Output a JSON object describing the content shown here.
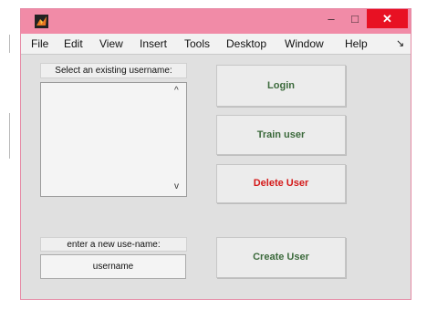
{
  "window": {
    "title_controls": {
      "minimize": "–",
      "maximize": "□",
      "close": "✕"
    }
  },
  "menu": {
    "items": [
      "File",
      "Edit",
      "View",
      "Insert",
      "Tools",
      "Desktop",
      "Window",
      "Help"
    ],
    "overflow_glyph": "↘"
  },
  "panel": {
    "select_label": "Select an existing username:",
    "new_label": "enter a new use-name:",
    "username_value": "username",
    "list_scroll_up": "^",
    "list_scroll_down": "v"
  },
  "buttons": {
    "login": "Login",
    "train": "Train user",
    "delete": "Delete User",
    "create": "Create User"
  },
  "colors": {
    "title_bar": "#f18ba7",
    "close_button": "#e81123",
    "button_text": "#3c6a3c",
    "delete_text": "#d41a1a"
  },
  "icons": {
    "app": "matlab-logo-icon"
  }
}
